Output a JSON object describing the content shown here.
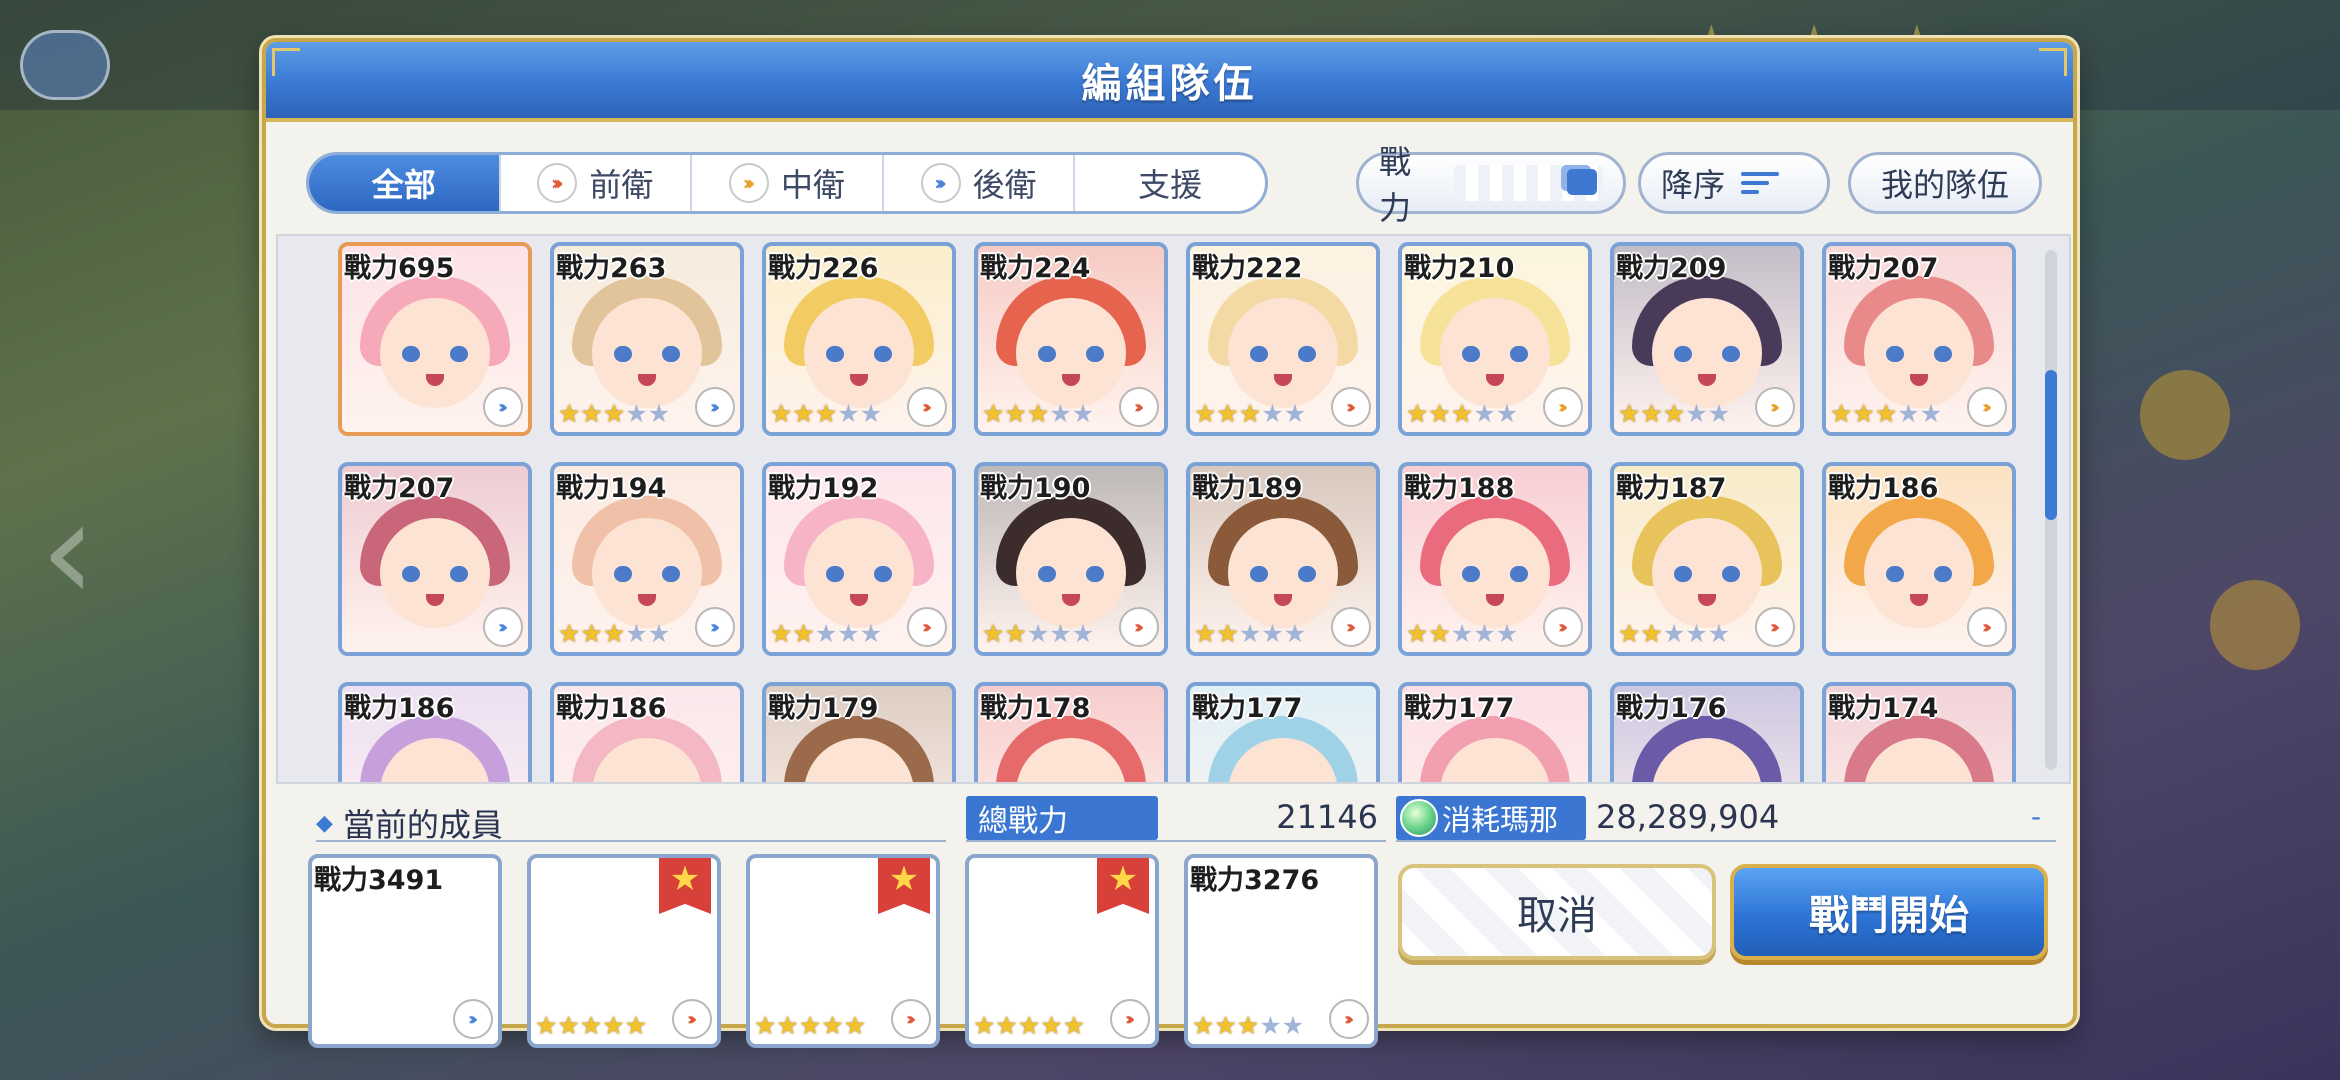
{
  "dialog": {
    "title": "編組隊伍"
  },
  "filters": {
    "tabs": [
      {
        "label": "全部",
        "icon": ""
      },
      {
        "label": "前衛",
        "icon": "front-chevron-icon"
      },
      {
        "label": "中衛",
        "icon": "middle-chevron-icon"
      },
      {
        "label": "後衛",
        "icon": "back-chevron-icon"
      },
      {
        "label": "支援",
        "icon": ""
      }
    ],
    "active": "全部",
    "sort_key": "戰力",
    "sort_order": "降序",
    "my_team": "我的隊伍"
  },
  "characters": [
    {
      "power": "戰力695",
      "stars": 0,
      "role": "back",
      "selected": true,
      "hair": "#f6a9b8"
    },
    {
      "power": "戰力263",
      "stars": 3,
      "role": "back",
      "hair": "#e2c49a"
    },
    {
      "power": "戰力226",
      "stars": 3,
      "role": "front",
      "hair": "#f2cc62"
    },
    {
      "power": "戰力224",
      "stars": 3,
      "role": "front",
      "hair": "#e6634e"
    },
    {
      "power": "戰力222",
      "stars": 3,
      "role": "front",
      "hair": "#f3d9a4"
    },
    {
      "power": "戰力210",
      "stars": 3,
      "role": "mid",
      "hair": "#f7e29a"
    },
    {
      "power": "戰力209",
      "stars": 3,
      "role": "mid",
      "hair": "#4a3a5a"
    },
    {
      "power": "戰力207",
      "stars": 3,
      "role": "mid",
      "hair": "#e88a8a"
    },
    {
      "power": "戰力207",
      "stars": 0,
      "role": "back",
      "hair": "#c9667a"
    },
    {
      "power": "戰力194",
      "stars": 3,
      "role": "back",
      "hair": "#f0c0a8"
    },
    {
      "power": "戰力192",
      "stars": 2,
      "role": "front",
      "hair": "#f7b4c6"
    },
    {
      "power": "戰力190",
      "stars": 2,
      "role": "front",
      "hair": "#3d2c2c"
    },
    {
      "power": "戰力189",
      "stars": 2,
      "role": "front",
      "hair": "#8a5a3a"
    },
    {
      "power": "戰力188",
      "stars": 2,
      "role": "front",
      "hair": "#ea6a7e"
    },
    {
      "power": "戰力187",
      "stars": 2,
      "role": "front",
      "hair": "#e8c25a"
    },
    {
      "power": "戰力186",
      "stars": 0,
      "role": "front",
      "hair": "#f2a848"
    },
    {
      "power": "戰力186",
      "stars": 0,
      "role": "back",
      "hair": "#c6a0dc"
    },
    {
      "power": "戰力186",
      "stars": 0,
      "role": "back",
      "hair": "#f3b8c4"
    },
    {
      "power": "戰力179",
      "stars": 0,
      "role": "back",
      "hair": "#9a6a4a"
    },
    {
      "power": "戰力178",
      "stars": 0,
      "role": "back",
      "hair": "#e66a6a"
    },
    {
      "power": "戰力177",
      "stars": 0,
      "role": "back",
      "hair": "#9fd2e6"
    },
    {
      "power": "戰力177",
      "stars": 0,
      "role": "back",
      "hair": "#f2a0b0"
    },
    {
      "power": "戰力176",
      "stars": 0,
      "role": "back",
      "hair": "#6a5aa8"
    },
    {
      "power": "戰力174",
      "stars": 0,
      "role": "back",
      "hair": "#d87a8a"
    }
  ],
  "members": {
    "label": "當前的成員",
    "list": [
      {
        "power": "戰力3491",
        "stars": 0,
        "role": "back",
        "badge": false,
        "hair": "#e8c4b4"
      },
      {
        "power": "",
        "stars": 5,
        "role": "front",
        "badge": true,
        "hair": "#e6b840"
      },
      {
        "power": "",
        "stars": 5,
        "role": "front",
        "badge": true,
        "hair": "#e0603a"
      },
      {
        "power": "",
        "stars": 5,
        "role": "front",
        "badge": true,
        "hair": "#f0a83a"
      },
      {
        "power": "戰力3276",
        "stars": 3,
        "role": "front",
        "badge": false,
        "hair": "#d85a72"
      }
    ]
  },
  "summary": {
    "total_label": "總戰力",
    "total_value": "21146",
    "mana_label": "消耗瑪那",
    "mana_value": "28,289,904",
    "mana_dash": "-"
  },
  "buttons": {
    "cancel": "取消",
    "start": "戰鬥開始"
  },
  "colors": {
    "accent": "#3b77d2",
    "gold_border": "#c8a64a",
    "selected_border": "#e89b55"
  }
}
